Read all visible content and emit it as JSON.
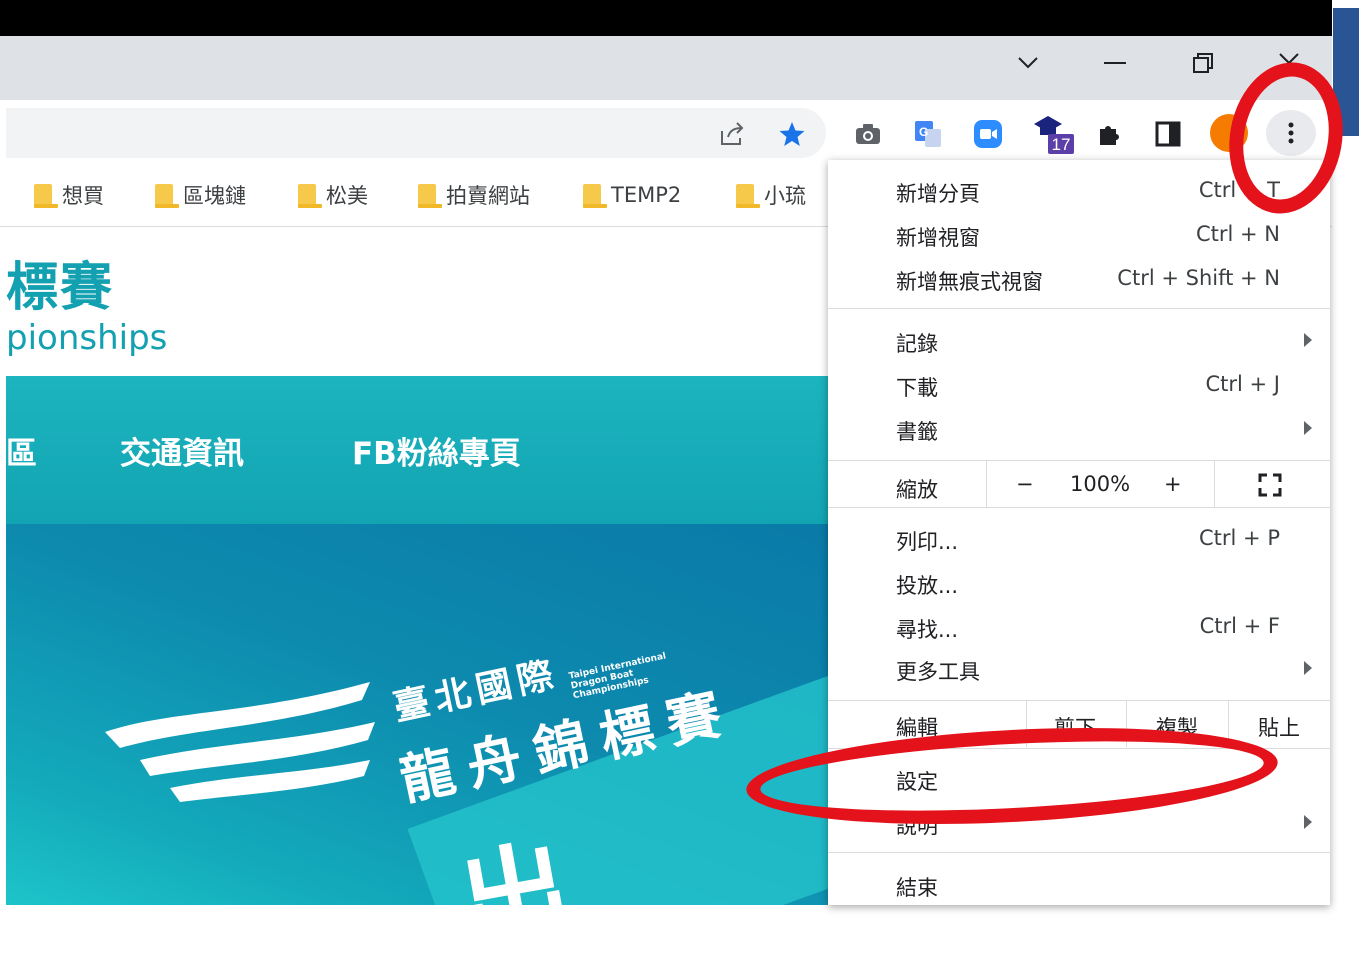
{
  "window": {
    "controls": [
      "﹀",
      "—",
      "❐",
      "╳"
    ]
  },
  "toolbar": {
    "icons": [
      "share-icon",
      "star-icon",
      "camera-icon",
      "translate-icon",
      "zoom-icon",
      "school-extension-icon",
      "puzzle-icon",
      "side-panel-icon",
      "profile-avatar",
      "more-menu-icon"
    ],
    "extension_badge": "17",
    "star_color": "#1a73e8"
  },
  "bookmarks": [
    "想買",
    "區塊鏈",
    "松美",
    "拍賣網站",
    "TEMP2",
    "小琉"
  ],
  "page": {
    "title_cn": "標賽",
    "title_en": "pionships",
    "nav": [
      "區",
      "交通資訊",
      "FB粉絲專頁"
    ],
    "logo_cn1": "臺北國際",
    "logo_cn2": "龍舟錦標賽",
    "logo_en1": "Taipei International",
    "logo_en2": "Dragon Boat",
    "logo_en3": "Championships",
    "hero_text": "出"
  },
  "menu": {
    "new_tab": {
      "label": "新增分頁",
      "shortcut": "Ctrl + T"
    },
    "new_window": {
      "label": "新增視窗",
      "shortcut": "Ctrl + N"
    },
    "new_incognito": {
      "label": "新增無痕式視窗",
      "shortcut": "Ctrl + Shift + N"
    },
    "history": {
      "label": "記錄"
    },
    "downloads": {
      "label": "下載",
      "shortcut": "Ctrl + J"
    },
    "bookmarks": {
      "label": "書籤"
    },
    "zoom": {
      "label": "縮放",
      "minus": "−",
      "value": "100%",
      "plus": "+"
    },
    "print": {
      "label": "列印...",
      "shortcut": "Ctrl + P"
    },
    "cast": {
      "label": "投放..."
    },
    "find": {
      "label": "尋找...",
      "shortcut": "Ctrl + F"
    },
    "more_tools": {
      "label": "更多工具"
    },
    "edit": {
      "label": "編輯",
      "cut": "剪下",
      "copy": "複製",
      "paste": "貼上"
    },
    "settings": {
      "label": "設定"
    },
    "help": {
      "label": "說明"
    },
    "exit": {
      "label": "結束"
    }
  },
  "annotation_color": "#e3121b"
}
